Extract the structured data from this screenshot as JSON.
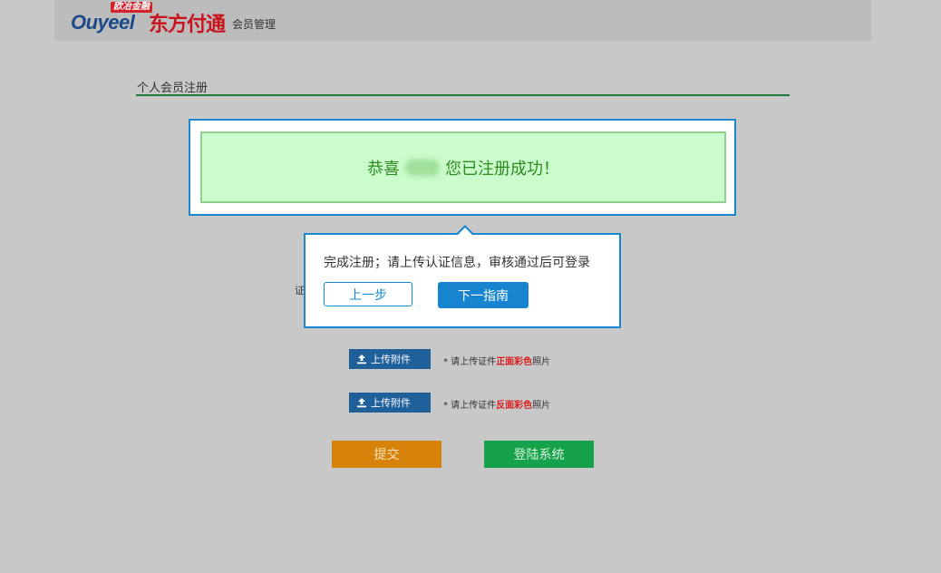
{
  "header": {
    "logo_badge": "欧冶金融",
    "logo_brand": "Ouyeel",
    "logo_cn": "东方付通",
    "logo_sub": "会员管理"
  },
  "page": {
    "title": "个人会员注册"
  },
  "success": {
    "prefix": "恭喜",
    "suffix": "您已注册成功！"
  },
  "tip": {
    "text": "完成注册；请上传认证信息，审核通过后可登录",
    "prev_label": "上一步",
    "next_label": "下一指南"
  },
  "form": {
    "cert_label_partial": "证",
    "uploads": [
      {
        "button_label": "上传附件",
        "note_prefix": "* 请上传证件",
        "note_highlight": "正面彩色",
        "note_suffix": "照片"
      },
      {
        "button_label": "上传附件",
        "note_prefix": "* 请上传证件",
        "note_highlight": "反面彩色",
        "note_suffix": "照片"
      }
    ],
    "submit_label": "提交",
    "login_label": "登陆系统"
  },
  "colors": {
    "accent_blue": "#1a88d0",
    "success_bg": "#cbfccb",
    "success_text": "#2e8b20",
    "submit_orange": "#d7820a",
    "login_green": "#15a24a",
    "highlight_red": "#d81e1e"
  }
}
